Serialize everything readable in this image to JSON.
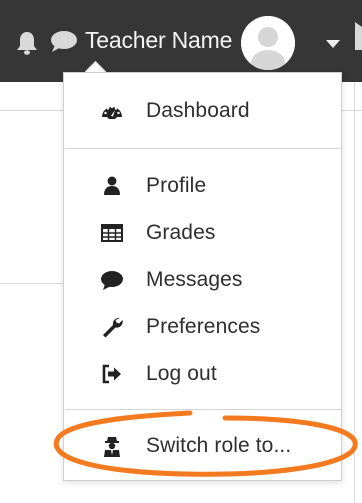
{
  "navbar": {
    "user_name": "Teacher Name",
    "icons": {
      "notifications": "bell-icon",
      "messages": "chat-bubble-icon",
      "avatar": "user-avatar",
      "menu_toggle": "caret-down-icon"
    }
  },
  "user_menu": {
    "items": [
      {
        "label": "Dashboard",
        "icon": "tachometer-icon"
      },
      {
        "label": "Profile",
        "icon": "user-icon"
      },
      {
        "label": "Grades",
        "icon": "table-icon"
      },
      {
        "label": "Messages",
        "icon": "comment-icon"
      },
      {
        "label": "Preferences",
        "icon": "wrench-icon"
      },
      {
        "label": "Log out",
        "icon": "sign-out-icon"
      },
      {
        "label": "Switch role to...",
        "icon": "user-secret-icon"
      }
    ]
  },
  "annotation": {
    "type": "hand-drawn ellipse",
    "color": "#f47a1f",
    "target": "Switch role to..."
  },
  "colors": {
    "navbar_bg": "#363636",
    "navbar_text": "#f4f4f4",
    "menu_text": "#2f2f2f",
    "menu_border": "#cfcfcf"
  }
}
